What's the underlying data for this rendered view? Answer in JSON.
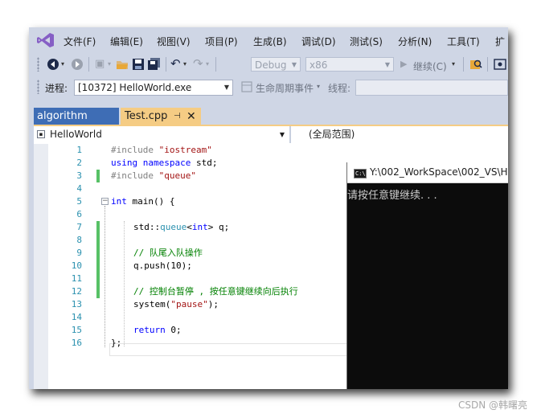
{
  "menu": {
    "items": [
      "文件(F)",
      "编辑(E)",
      "视图(V)",
      "项目(P)",
      "生成(B)",
      "调试(D)",
      "测试(S)",
      "分析(N)",
      "工具(T)",
      "扩"
    ]
  },
  "toolbar": {
    "config_value": "Debug",
    "platform_value": "x86",
    "continue_label": "继续(C)",
    "process_label": "进程:",
    "process_value": "[10372] HelloWorld.exe",
    "lifecycle_label": "生命周期事件",
    "thread_label": "线程:"
  },
  "tabs": {
    "solution_tab": "algorithm",
    "file_tab": "Test.cpp",
    "pin_glyph": "⊣",
    "close_glyph": "✕"
  },
  "navbar": {
    "scope_left": "HelloWorld",
    "scope_right": "(全局范围)"
  },
  "editor": {
    "line_numbers": [
      "1",
      "2",
      "3",
      "4",
      "5",
      "6",
      "7",
      "8",
      "9",
      "10",
      "11",
      "12",
      "13",
      "14",
      "15",
      "16"
    ],
    "lines": {
      "l1_pp": "#include ",
      "l1_str": "\"iostream\"",
      "l2_kw1": "using",
      "l2_kw2": "namespace",
      "l2_rest": " std;",
      "l3_pp": "#include ",
      "l3_str": "\"queue\"",
      "l5_kw": "int",
      "l5_rest": " main() {",
      "l7_a": "std::",
      "l7_type": "queue",
      "l7_lt": "<",
      "l7_kw": "int",
      "l7_rest": "> q;",
      "l9_cm": "// 队尾入队操作",
      "l10": "q.push(10);",
      "l12_cm": "// 控制台暂停 , 按任意键继续向后执行",
      "l13_a": "system(",
      "l13_str": "\"pause\"",
      "l13_b": ");",
      "l15_kw": "return",
      "l15_rest": " 0;",
      "l16": "};"
    }
  },
  "console": {
    "icon_text": "C:\\",
    "title": "Y:\\002_WorkSpace\\002_VS\\He",
    "output": "请按任意键继续. . ."
  },
  "watermark": "CSDN @韩曙亮",
  "colors": {
    "chrome": "#cfd6e5",
    "tab_active": "#f5cc84",
    "tab_inactive": "#3e6db5",
    "change_bar": "#57c166",
    "vs_purple": "#865fc5"
  }
}
